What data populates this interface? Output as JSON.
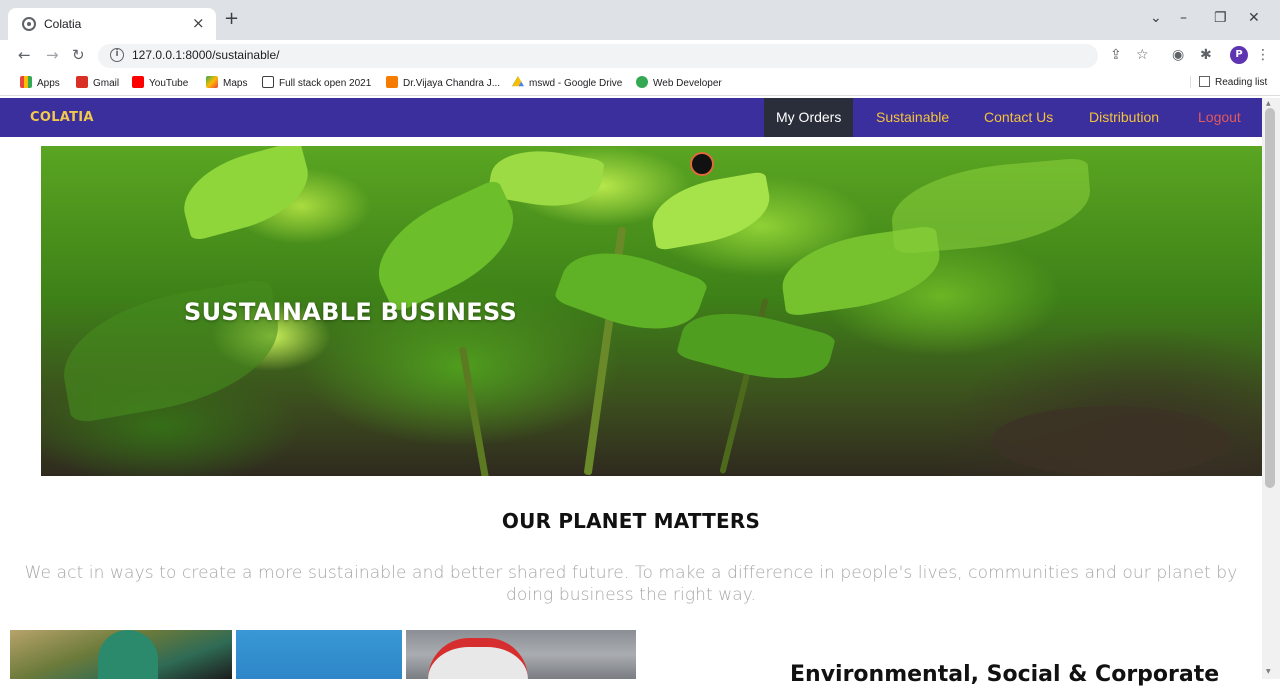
{
  "browser": {
    "tab_title": "Colatia",
    "tab_close": "×",
    "new_tab": "+",
    "url": "127.0.0.1:8000/sustainable/",
    "info_glyph": "i",
    "profile_initial": "P",
    "reading_list": "Reading list"
  },
  "bookmarks": [
    {
      "label": "Apps",
      "color": "#e8453c"
    },
    {
      "label": "Gmail",
      "color": "#d93025"
    },
    {
      "label": "YouTube",
      "color": "#ff0000"
    },
    {
      "label": "Maps",
      "color": "#34a853"
    },
    {
      "label": "Full stack open 2021",
      "color": "#ffffff"
    },
    {
      "label": "Dr.Vijaya Chandra J...",
      "color": "#f57c00"
    },
    {
      "label": "mswd - Google Drive",
      "color": "#1a73e8"
    },
    {
      "label": "Web Developer",
      "color": "#34a853"
    }
  ],
  "site": {
    "brand": "COLATIA",
    "nav": {
      "my_orders": "My Orders",
      "sustainable": "Sustainable",
      "contact_us": "Contact Us",
      "distribution": "Distribution",
      "logout": "Logout"
    },
    "colors": {
      "nav_bg": "#3a2f9c",
      "nav_link": "#f5c33b",
      "logout": "#e35a5a"
    }
  },
  "hero": {
    "title": "SUSTAINABLE BUSINESS"
  },
  "planet": {
    "heading": "OUR PLANET MATTERS",
    "text": "We act in ways to create a more sustainable and better shared future. To make a difference in people's lives, communities and our planet by doing business the right way."
  },
  "esg": {
    "heading": "Environmental, Social & Corporate"
  }
}
